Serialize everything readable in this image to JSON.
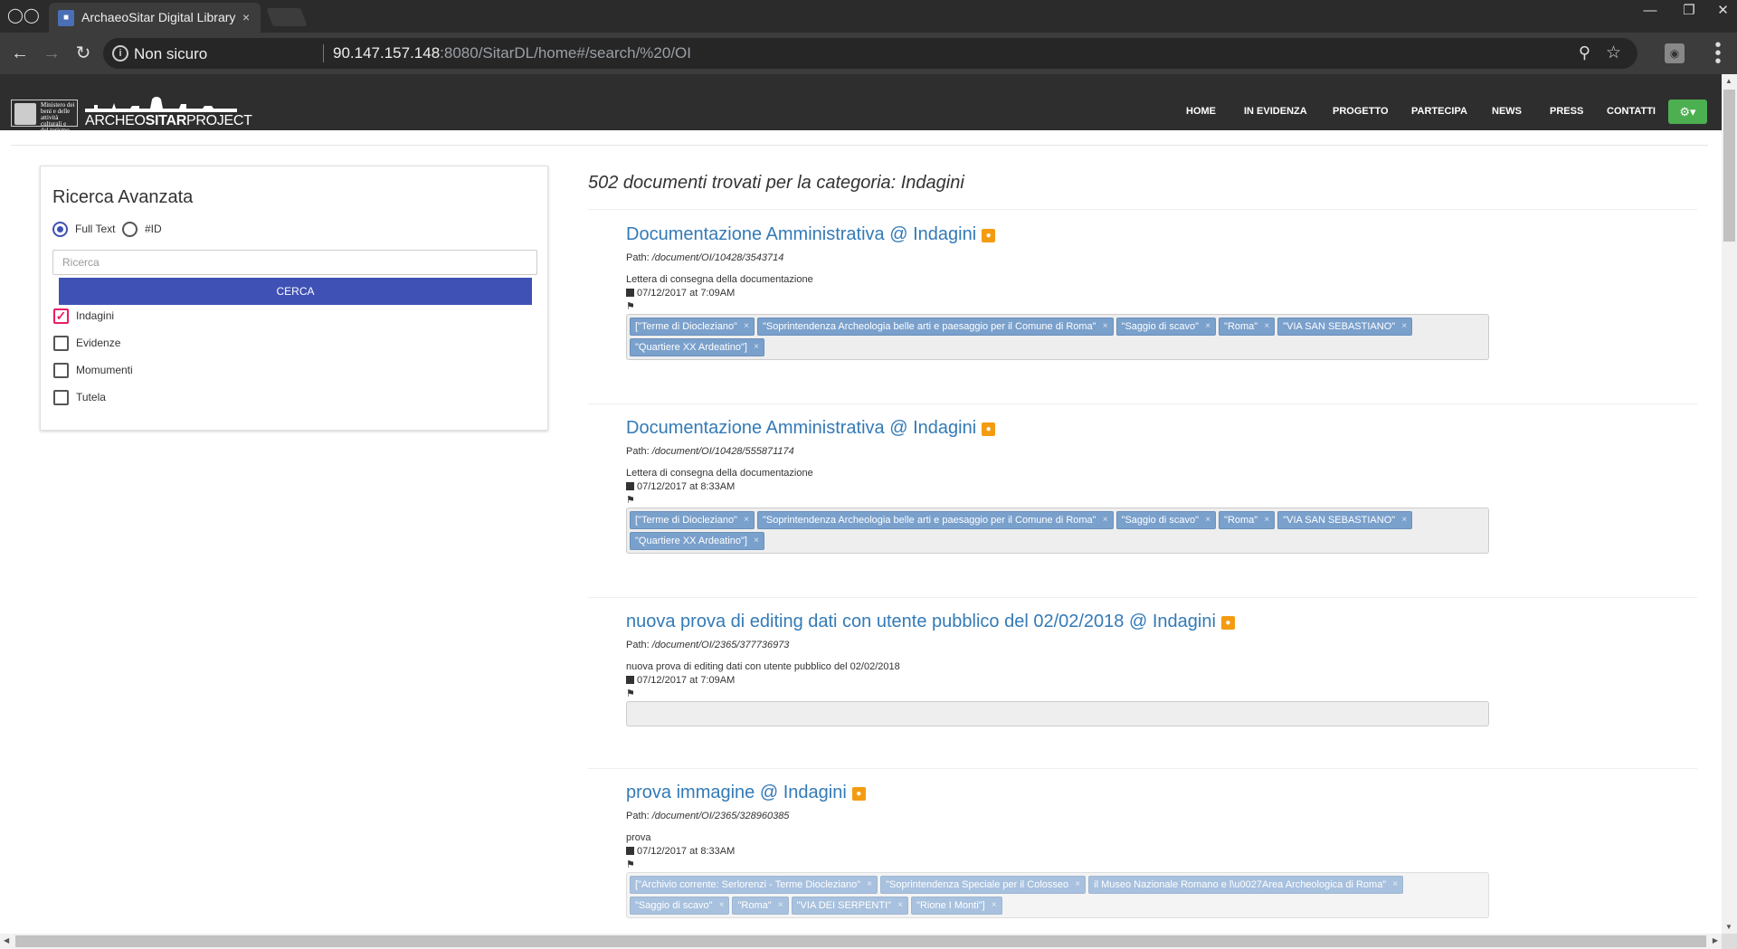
{
  "browser": {
    "tab_title": "ArchaeoSitar Digital Library",
    "tab_close": "×",
    "security_label": "Non sicuro",
    "url_host": "90.147.157.148",
    "url_rest": ":8080/SitarDL/home#/search/%20/OI"
  },
  "site": {
    "logo_ministry": "Ministero dei beni e delle attività culturali e del turismo",
    "logo_text_a": "ARCHEO",
    "logo_text_b": "SITAR",
    "logo_text_c": "PROJECT",
    "nav": [
      {
        "label": "HOME"
      },
      {
        "label": "IN EVIDENZA"
      },
      {
        "label": "PROGETTO"
      },
      {
        "label": "PARTECIPA"
      },
      {
        "label": "NEWS"
      },
      {
        "label": "PRESS"
      },
      {
        "label": "CONTATTI"
      }
    ]
  },
  "sidebar": {
    "title": "Ricerca Avanzata",
    "radio_fulltext": "Full Text",
    "radio_id": "#ID",
    "search_placeholder": "Ricerca",
    "search_button": "CERCA",
    "categories": [
      {
        "label": "Indagini",
        "checked": true
      },
      {
        "label": "Evidenze",
        "checked": false
      },
      {
        "label": "Momumenti",
        "checked": false
      },
      {
        "label": "Tutela",
        "checked": false
      }
    ]
  },
  "results": {
    "heading": "502 documenti trovati per la categoria: Indagini",
    "path_prefix": "Path:",
    "items": [
      {
        "title": "Documentazione Amministrativa @ Indagini",
        "path": "/document/OI/10428/3543714",
        "description": "Lettera di consegna della documentazione",
        "date": "07/12/2017 at 7:09AM",
        "tags": [
          "[\"Terme di Diocleziano\"",
          "\"Soprintendenza Archeologia belle arti e paesaggio per il Comune di Roma\"",
          "\"Saggio di scavo\"",
          "\"Roma\"",
          "\"VIA SAN SEBASTIANO\"",
          "\"Quartiere XX Ardeatino\"]"
        ]
      },
      {
        "title": "Documentazione Amministrativa @ Indagini",
        "path": "/document/OI/10428/555871174",
        "description": "Lettera di consegna della documentazione",
        "date": "07/12/2017 at 8:33AM",
        "tags": [
          "[\"Terme di Diocleziano\"",
          "\"Soprintendenza Archeologia belle arti e paesaggio per il Comune di Roma\"",
          "\"Saggio di scavo\"",
          "\"Roma\"",
          "\"VIA SAN SEBASTIANO\"",
          "\"Quartiere XX Ardeatino\"]"
        ]
      },
      {
        "title": "nuova prova di editing dati con utente pubblico del 02/02/2018 @ Indagini",
        "path": "/document/OI/2365/377736973",
        "description": "nuova prova di editing dati con utente pubblico del 02/02/2018",
        "date": "07/12/2017 at 7:09AM",
        "tags": []
      },
      {
        "title": "prova immagine @ Indagini",
        "path": "/document/OI/2365/328960385",
        "description": "prova",
        "date": "07/12/2017 at 8:33AM",
        "tags": [
          "[\"Archivio corrente: Serlorenzi - Terme Diocleziano\"",
          "\"Soprintendenza Speciale per il Colosseo",
          "il Museo Nazionale Romano e l\\u0027Area Archeologica di Roma\"",
          "\"Saggio di scavo\"",
          "\"Roma\"",
          "\"VIA DEI SERPENTI\"",
          "\"Rione I Monti\"]"
        ]
      }
    ]
  },
  "colors": {
    "header_bg": "#2e2e2e",
    "primary": "#3f51b5",
    "link": "#337ab7",
    "tag": "#7aa0cc",
    "checkbox_on": "#e91e63",
    "gear_button": "#4caf50",
    "rss": "#f39c12"
  }
}
